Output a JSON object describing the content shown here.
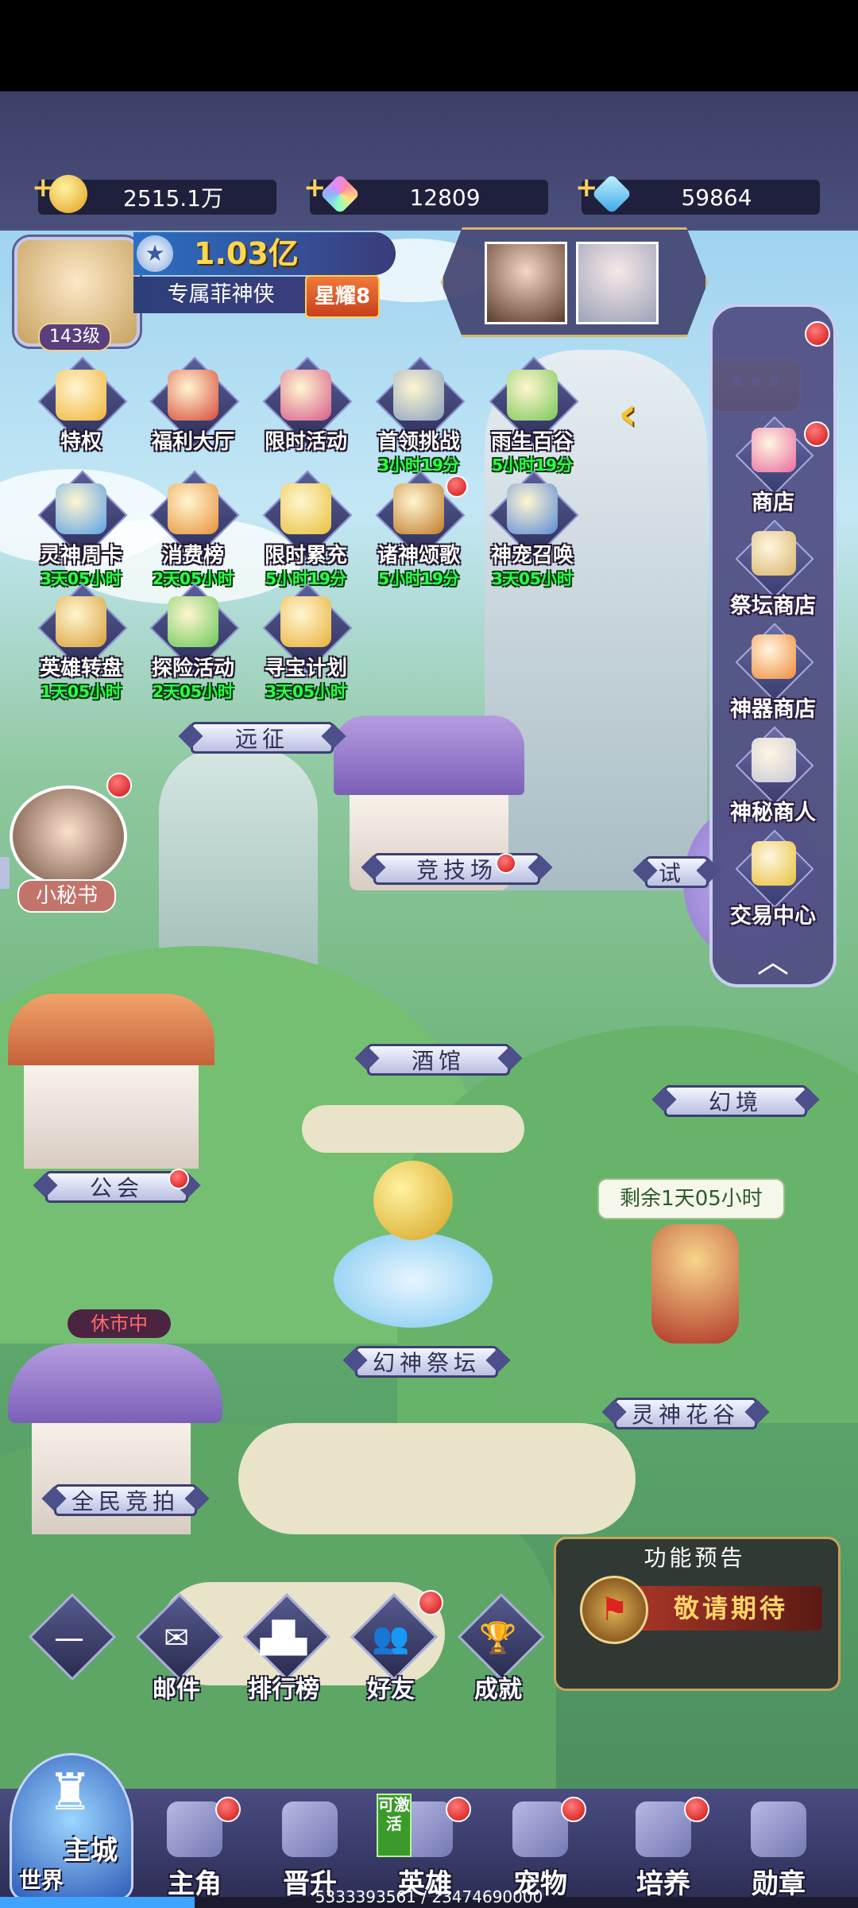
{
  "resources": [
    {
      "icon": "gold-coin-icon",
      "value": "2515.1万"
    },
    {
      "icon": "rainbow-crystal-icon",
      "value": "12809"
    },
    {
      "icon": "blue-diamond-icon",
      "value": "59864"
    }
  ],
  "player": {
    "level": "143级",
    "power": "1.03亿",
    "title": "专属菲神侠",
    "star_badge": "星耀8"
  },
  "activities": [
    {
      "label": "特权",
      "timer": "",
      "badge": false
    },
    {
      "label": "福利大厅",
      "timer": "",
      "badge": false
    },
    {
      "label": "限时活动",
      "timer": "",
      "badge": false
    },
    {
      "label": "首领挑战",
      "timer": "3小时19分",
      "badge": false
    },
    {
      "label": "雨生百谷",
      "timer": "5小时19分",
      "badge": false
    },
    {
      "label": "灵神周卡",
      "timer": "3天05小时",
      "badge": false
    },
    {
      "label": "消费榜",
      "timer": "2天05小时",
      "badge": false
    },
    {
      "label": "限时累充",
      "timer": "5小时19分",
      "badge": false
    },
    {
      "label": "诸神颂歌",
      "timer": "5小时19分",
      "badge": true
    },
    {
      "label": "神宠召唤",
      "timer": "3天05小时",
      "badge": false
    },
    {
      "label": "英雄转盘",
      "timer": "1天05小时",
      "badge": false
    },
    {
      "label": "探险活动",
      "timer": "2天05小时",
      "badge": false
    },
    {
      "label": "寻宝计划",
      "timer": "3天05小时",
      "badge": false
    }
  ],
  "shop_panel": [
    {
      "label": "商店",
      "badge": true
    },
    {
      "label": "祭坛商店",
      "badge": false
    },
    {
      "label": "神器商店",
      "badge": false
    },
    {
      "label": "神秘商人",
      "badge": false
    },
    {
      "label": "交易中心",
      "badge": false
    }
  ],
  "map_labels": {
    "expedition": "远征",
    "arena": "竞技场",
    "trial": "试",
    "tavern": "酒馆",
    "illusion": "幻境",
    "guild": "公会",
    "altar": "幻神祭坛",
    "flower_valley": "灵神花谷",
    "auction": "全民竞拍",
    "market_status": "休市中",
    "secretary": "小秘书",
    "flower_timer": "剩余1天05小时"
  },
  "feature_preview": {
    "title": "功能预告",
    "text": "敬请期待"
  },
  "mini_menu": [
    {
      "label": "",
      "icon": "minus-icon",
      "glyph": "—"
    },
    {
      "label": "邮件",
      "icon": "mail-icon",
      "glyph": "✉"
    },
    {
      "label": "排行榜",
      "icon": "podium-icon",
      "glyph": "▟▙"
    },
    {
      "label": "好友",
      "icon": "friends-icon",
      "glyph": "👥"
    },
    {
      "label": "成就",
      "icon": "trophy-icon",
      "glyph": "🏆"
    }
  ],
  "nav": {
    "city_label": "主城",
    "world_label": "世界",
    "activate_tag": "可激活",
    "items": [
      {
        "label": "主角",
        "badge": true
      },
      {
        "label": "晋升",
        "badge": false
      },
      {
        "label": "英雄",
        "badge": true
      },
      {
        "label": "宠物",
        "badge": true
      },
      {
        "label": "培养",
        "badge": true
      },
      {
        "label": "勋章",
        "badge": false
      }
    ]
  },
  "footer_id": "5333393561 / 23474690000",
  "colors": {
    "topbar": "#4b4f7c",
    "panel": "#4e4c82",
    "timer_green": "#2bff4a",
    "badge_red": "#d01010",
    "gold": "#f7d25c"
  }
}
